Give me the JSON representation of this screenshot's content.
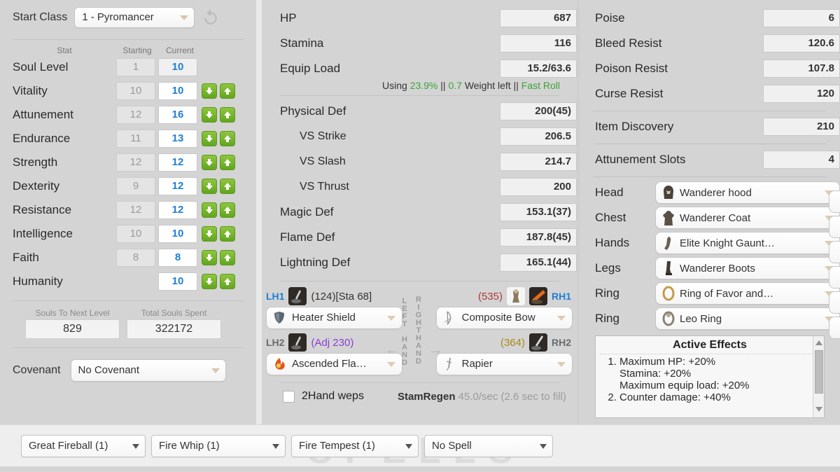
{
  "left": {
    "start_class_label": "Start Class",
    "start_class_value": "1 - Pyromancer",
    "reset_icon": "reset-arrow-icon",
    "headers": {
      "stat": "Stat",
      "starting": "Starting",
      "current": "Current"
    },
    "stats": [
      {
        "name": "Soul Level",
        "starting": "1",
        "current": "10",
        "arrows": false
      },
      {
        "name": "Vitality",
        "starting": "10",
        "current": "10",
        "arrows": true
      },
      {
        "name": "Attunement",
        "starting": "12",
        "current": "16",
        "arrows": true
      },
      {
        "name": "Endurance",
        "starting": "11",
        "current": "13",
        "arrows": true
      },
      {
        "name": "Strength",
        "starting": "12",
        "current": "12",
        "arrows": true
      },
      {
        "name": "Dexterity",
        "starting": "9",
        "current": "12",
        "arrows": true
      },
      {
        "name": "Resistance",
        "starting": "12",
        "current": "12",
        "arrows": true
      },
      {
        "name": "Intelligence",
        "starting": "10",
        "current": "10",
        "arrows": true
      },
      {
        "name": "Faith",
        "starting": "8",
        "current": "8",
        "arrows": true
      },
      {
        "name": "Humanity",
        "starting": "",
        "current": "10",
        "arrows": true
      }
    ],
    "souls_next_label": "Souls To Next Level",
    "souls_next_value": "829",
    "souls_spent_label": "Total Souls Spent",
    "souls_spent_value": "322172",
    "covenant_label": "Covenant",
    "covenant_value": "No Covenant"
  },
  "mid": {
    "vitals": [
      {
        "name": "HP",
        "value": "687"
      },
      {
        "name": "Stamina",
        "value": "116"
      },
      {
        "name": "Equip Load",
        "value": "15.2/63.6"
      }
    ],
    "equip_note": {
      "using_word": "Using",
      "using_pct": "23.9%",
      "sep1": "||",
      "weight_left": "0.7",
      "weight_word": "Weight left",
      "sep2": "||",
      "roll": "Fast Roll"
    },
    "defenses": [
      {
        "name": "Physical Def",
        "value": "200(45)",
        "indent": false
      },
      {
        "name": "VS Strike",
        "value": "206.5",
        "indent": true
      },
      {
        "name": "VS Slash",
        "value": "214.7",
        "indent": true
      },
      {
        "name": "VS Thrust",
        "value": "200",
        "indent": true
      },
      {
        "name": "Magic Def",
        "value": "153.1(37)",
        "indent": false
      },
      {
        "name": "Flame Def",
        "value": "187.8(45)",
        "indent": false
      },
      {
        "name": "Lightning Def",
        "value": "165.1(44)",
        "indent": false
      }
    ],
    "left_hand_vertical": "LEFT HAND",
    "right_hand_vertical": "RIGHTHAND",
    "weapons": {
      "lh1_tag": "LH1",
      "lh1_stat": "(124)[Sta 68]",
      "lh1_item": "Heater Shield",
      "lh2_tag": "LH2",
      "lh2_stat": "(Adj 230)",
      "lh2_item": "Ascended Fla…",
      "rh1_tag": "RH1",
      "rh1_stat": "(535)",
      "rh1_item": "Composite Bow",
      "rh2_tag": "RH2",
      "rh2_stat": "(364)",
      "rh2_item": "Rapier"
    },
    "twohand_label": "2Hand weps",
    "stamregen_label": "StamRegen",
    "stamregen_value": "45.0/sec (2.6 sec to fill)"
  },
  "right": {
    "resists": [
      {
        "name": "Poise",
        "value": "6"
      },
      {
        "name": "Bleed Resist",
        "value": "120.6"
      },
      {
        "name": "Poison Resist",
        "value": "107.8"
      },
      {
        "name": "Curse Resist",
        "value": "120"
      }
    ],
    "item_discovery": {
      "name": "Item Discovery",
      "value": "210"
    },
    "attunement_slots": {
      "name": "Attunement Slots",
      "value": "4"
    },
    "equipment": [
      {
        "slot": "Head",
        "item": "Wanderer hood"
      },
      {
        "slot": "Chest",
        "item": "Wanderer Coat"
      },
      {
        "slot": "Hands",
        "item": "Elite Knight Gaunt…"
      },
      {
        "slot": "Legs",
        "item": "Wanderer Boots"
      },
      {
        "slot": "Ring",
        "item": "Ring of Favor and…"
      },
      {
        "slot": "Ring",
        "item": "Leo Ring"
      }
    ],
    "effects_title": "Active Effects",
    "effects": [
      {
        "num": "1.",
        "lines": [
          "Maximum HP: +20%",
          "Stamina: +20%",
          "Maximum equip load: +20%"
        ]
      },
      {
        "num": "2.",
        "lines": [
          "Counter damage: +40%"
        ]
      }
    ]
  },
  "spellbar": {
    "watermark": "SPELLS",
    "slots": [
      "Great Fireball (1)",
      "Fire Whip (1)",
      "Fire Tempest (1)",
      "No Spell"
    ]
  },
  "colors": {
    "accent_blue": "#1f7fd4",
    "green": "#3aa33a",
    "arrow_green": "#63a51f",
    "red": "#b03a3a",
    "gold": "#a88a18",
    "purple": "#8a3fd4",
    "panel_bg": "#d4d4d4"
  }
}
